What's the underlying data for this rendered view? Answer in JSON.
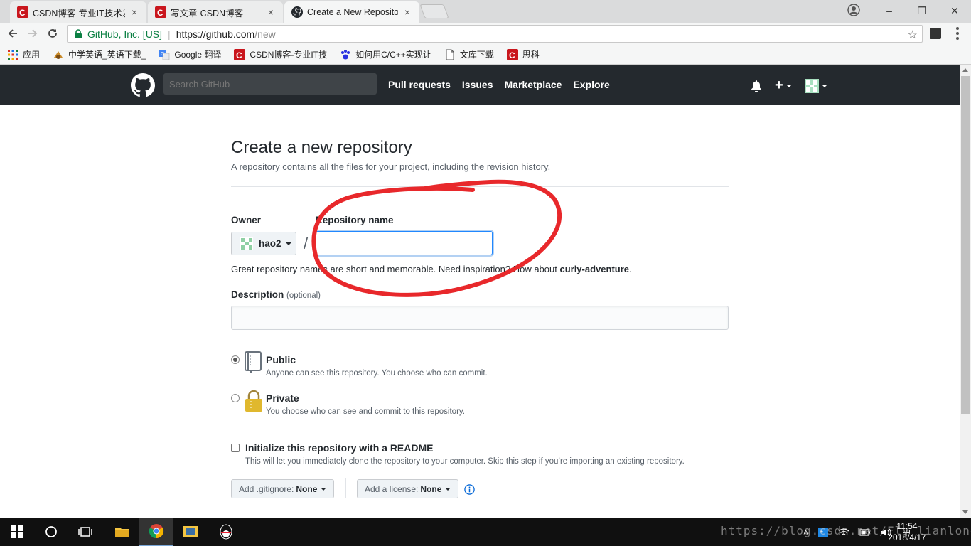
{
  "browser": {
    "tabs": [
      {
        "label": "CSDN博客-专业IT技术发",
        "close": "×",
        "icon": "csdn-icon"
      },
      {
        "label": "写文章-CSDN博客",
        "close": "×",
        "icon": "csdn-icon"
      },
      {
        "label": "Create a New Reposito",
        "close": "×",
        "icon": "github-icon"
      }
    ],
    "window_controls": {
      "minimize": "–",
      "maximize": "❐",
      "close": "✕"
    },
    "address": {
      "secure_label": "GitHub, Inc. [US]",
      "host": "https://github.com",
      "path": "/new"
    },
    "bookmarks": [
      {
        "label": "应用",
        "icon": "apps-grid-icon"
      },
      {
        "label": "中学英语_英语下载_",
        "icon": "bookmark-site-icon"
      },
      {
        "label": "Google 翻译",
        "icon": "google-translate-icon"
      },
      {
        "label": "CSDN博客-专业IT技",
        "icon": "csdn-icon"
      },
      {
        "label": "如何用C/C++实现让",
        "icon": "baidu-paw-icon"
      },
      {
        "label": "文库下载",
        "icon": "document-icon"
      },
      {
        "label": "思科",
        "icon": "csdn-icon"
      }
    ]
  },
  "github": {
    "search_placeholder": "Search GitHub",
    "nav": [
      "Pull requests",
      "Issues",
      "Marketplace",
      "Explore"
    ],
    "plus": "+"
  },
  "form": {
    "title": "Create a new repository",
    "subtitle": "A repository contains all the files for your project, including the revision history.",
    "owner_label": "Owner",
    "owner_value": "hao2",
    "slash": "/",
    "repo_label": "Repository name",
    "repo_value": "",
    "hint_prefix": "Great repository names are short and memorable. Need inspiration? How about ",
    "hint_suggestion": "curly-adventure",
    "hint_suffix": ".",
    "description_label": "Description",
    "description_optional": "(optional)",
    "description_value": "",
    "visibility": [
      {
        "title": "Public",
        "note": "Anyone can see this repository. You choose who can commit.",
        "selected": true,
        "icon": "repo-book-icon"
      },
      {
        "title": "Private",
        "note": "You choose who can see and commit to this repository.",
        "selected": false,
        "icon": "lock-icon"
      }
    ],
    "readme_title": "Initialize this repository with a README",
    "readme_note": "This will let you immediately clone the repository to your computer. Skip this step if you’re importing an existing repository.",
    "readme_checked": false,
    "gitignore_label": "Add .gitignore:",
    "gitignore_value": "None",
    "license_label": "Add a license:",
    "license_value": "None"
  },
  "taskbar": {
    "clock_time": "11:54",
    "clock_date": "2018/4/17",
    "ime": "中",
    "watermark": "https://blog.csdn.net/Fly_lianlong"
  },
  "colors": {
    "header_bg": "#24292e",
    "annotation": "#e8282b",
    "focus": "#2188ff",
    "secure": "#0b8043"
  }
}
